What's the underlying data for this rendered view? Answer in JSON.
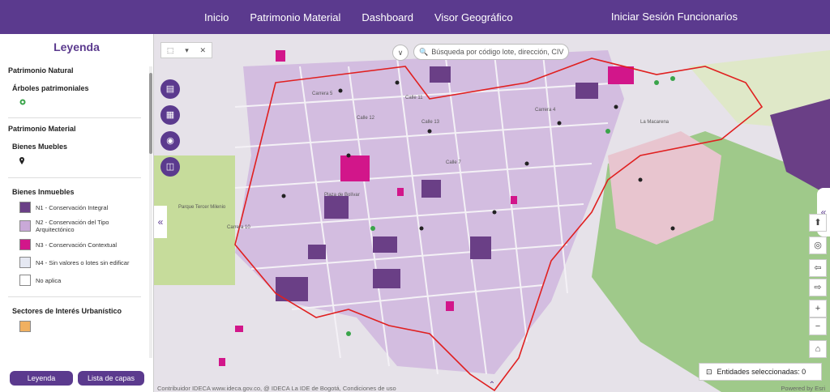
{
  "nav": {
    "items": [
      "Inicio",
      "Patrimonio Material",
      "Dashboard",
      "Visor Geográfico"
    ],
    "login": "Iniciar Sesión Funcionarios"
  },
  "sidebar": {
    "title": "Leyenda",
    "sections": {
      "natural": "Patrimonio Natural",
      "trees": "Árboles patrimoniales",
      "material": "Patrimonio Material",
      "movable": "Bienes Muebles",
      "immovable": "Bienes Inmuebles",
      "urban": "Sectores de Interés Urbanístico"
    },
    "legend": [
      {
        "label": "N1 - Conservación Integral",
        "color": "#6a3f86"
      },
      {
        "label": "N2 - Conservación del Tipo Arquitectónico",
        "color": "#c9a9d8"
      },
      {
        "label": "N3 - Conservación Contextual",
        "color": "#d2168a"
      },
      {
        "label": "N4 - Sin valores o lotes sin edificar",
        "color": "#e5e8f2"
      },
      {
        "label": "No aplica",
        "color": "#ffffff"
      }
    ],
    "urban_swatch_color": "#f0b060",
    "buttons": {
      "legend": "Leyenda",
      "layers": "Lista de capas"
    }
  },
  "map": {
    "search_placeholder": "Búsqueda por código lote, dirección, CIV",
    "entities_label": "Entidades seleccionadas: 0",
    "attribution": "Contribuidor IDECA www.ideca.gov.co, @ IDECA La IDE de Bogotá, Condiciones de uso",
    "powered": "Powered by Esri",
    "street_labels": [
      "Calle 12",
      "Calle 11",
      "Calle 13",
      "Carrera 5",
      "Carrera 4",
      "Carrera 10",
      "Calle 7",
      "Plaza de Bolívar",
      "La Macarena",
      "Parque Tercer Milenio"
    ],
    "colors": {
      "accent": "#5b3a8e",
      "n1": "#6a3f86",
      "n2": "#c9a9d8",
      "n3": "#d2168a",
      "boundary": "#e02020",
      "green": "#9fc98a"
    }
  }
}
